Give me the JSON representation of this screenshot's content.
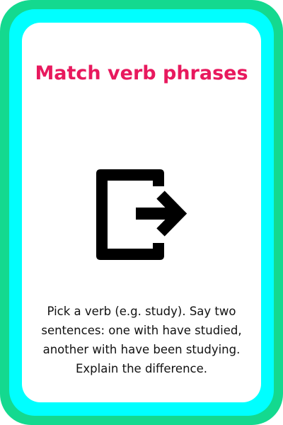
{
  "card": {
    "title": "Match verb phrases",
    "icon": "exit-arrow-icon",
    "description": "Pick a verb (e.g. study). Say two sentences: one with have studied, another with have been studying. Explain the difference."
  },
  "colors": {
    "outer_border": "#14d98f",
    "inner_border": "#00ffff",
    "title": "#e8195e",
    "text": "#111111",
    "icon": "#000000",
    "background": "#ffffff"
  }
}
